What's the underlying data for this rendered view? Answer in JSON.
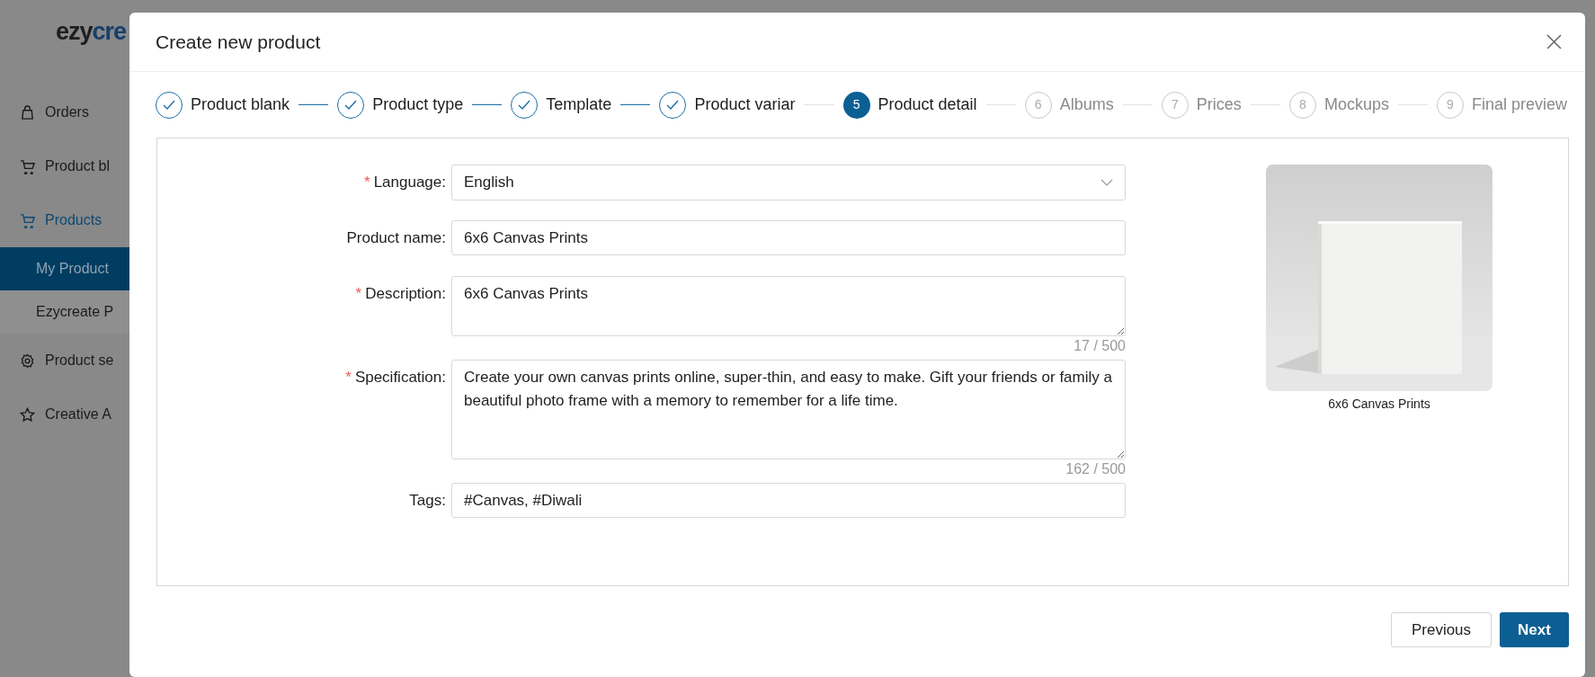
{
  "logo": {
    "text_dark": "ezy",
    "text_blue": "cre"
  },
  "sidebar": {
    "items": [
      {
        "label": "Orders",
        "expanded": false
      },
      {
        "label": "Product bl",
        "expanded": false
      },
      {
        "label": "Products",
        "expanded": true,
        "children": [
          {
            "label": "My Product",
            "selected": true
          },
          {
            "label": "Ezycreate P",
            "selected": false
          }
        ]
      },
      {
        "label": "Product se",
        "expanded": false
      },
      {
        "label": "Creative A",
        "expanded": false
      }
    ]
  },
  "modal": {
    "title": "Create new product",
    "steps": [
      {
        "label": "Product blank",
        "completed": true,
        "selected": false
      },
      {
        "label": "Product type",
        "completed": true,
        "selected": false
      },
      {
        "label": "Template",
        "completed": true,
        "selected": false
      },
      {
        "label": "Product variar",
        "completed": true,
        "selected": false
      },
      {
        "number": "5",
        "label": "Product detail",
        "completed": false,
        "selected": true
      },
      {
        "number": "6",
        "label": "Albums",
        "completed": false,
        "selected": false
      },
      {
        "number": "7",
        "label": "Prices",
        "completed": false,
        "selected": false
      },
      {
        "number": "8",
        "label": "Mockups",
        "completed": false,
        "selected": false
      },
      {
        "number": "9",
        "label": "Final preview",
        "completed": false,
        "selected": false
      }
    ],
    "fields": [
      {
        "kind": "select",
        "required_mark": "*",
        "label": "Language:",
        "value": "English"
      },
      {
        "kind": "input",
        "label": "Product name:",
        "value": "6x6 Canvas Prints"
      },
      {
        "kind": "textarea",
        "required_mark": "*",
        "label": "Description:",
        "value": "6x6 Canvas Prints",
        "counter": "17 / 500"
      },
      {
        "kind": "textarea",
        "required_mark": "*",
        "label": "Specification:",
        "value": "Create your own canvas prints online, super-thin, and easy to make. Gift your friends or family a beautiful photo frame with a memory to remember for a life time.",
        "counter": "162 / 500"
      },
      {
        "kind": "input",
        "label": "Tags:",
        "value": "#Canvas, #Diwali"
      }
    ],
    "preview": {
      "kind": "picture",
      "caption": "6x6 Canvas Prints"
    },
    "buttons": [
      {
        "label": "Previous",
        "kind": "secondary"
      },
      {
        "label": "Next",
        "kind": "primary"
      }
    ]
  }
}
